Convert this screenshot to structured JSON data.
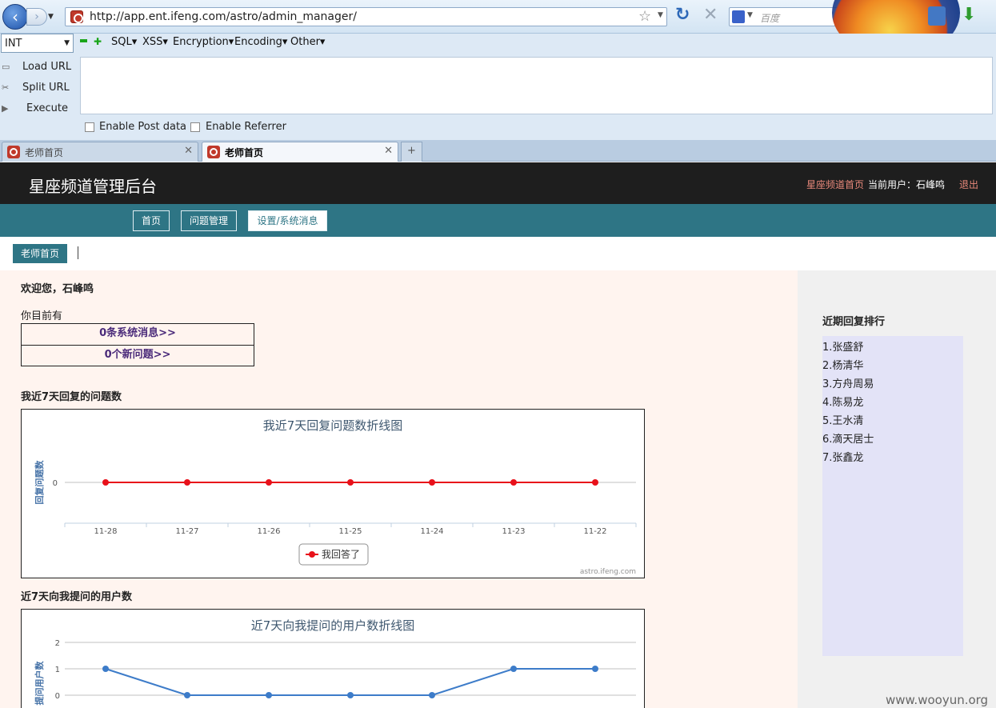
{
  "browser": {
    "url": "http://app.ent.ifeng.com/astro/admin_manager/",
    "search_placeholder": "百度",
    "back_glyph": "‹",
    "forward_glyph": "›",
    "reload_glyph": "↻",
    "stop_glyph": "✕",
    "star_glyph": "☆"
  },
  "hackbar": {
    "select_value": "INT",
    "menus": [
      "SQL",
      "XSS",
      "Encryption",
      "Encoding",
      "Other"
    ],
    "actions": [
      "Load URL",
      "Split URL",
      "Execute"
    ],
    "checkboxes": [
      "Enable Post data",
      "Enable Referrer"
    ]
  },
  "tabs": [
    {
      "title": "老师首页",
      "active": false
    },
    {
      "title": "老师首页",
      "active": true
    }
  ],
  "site": {
    "title": "星座频道管理后台",
    "home_link": "星座频道首页",
    "current_user": "当前用户：石峰鸣",
    "logout": "退出"
  },
  "nav": [
    {
      "label": "首页",
      "active": false
    },
    {
      "label": "问题管理",
      "active": false
    },
    {
      "label": "设置/系统消息",
      "active": true
    }
  ],
  "breadcrumb": "老师首页",
  "main": {
    "welcome": "欢迎您，石峰鸣",
    "current": "你目前有",
    "messages": "0条系统消息>>",
    "questions": "0个新问题>>",
    "section1": "我近7天回复的问题数",
    "section2": "近7天向我提问的用户数"
  },
  "sidebar": {
    "title": "近期回复排行",
    "items": [
      "1.张盛舒",
      "2.杨清华",
      "3.方舟周易",
      "4.陈易龙",
      "5.王水清",
      "6.滴天居士",
      "7.张鑫龙"
    ]
  },
  "chart_data": [
    {
      "type": "line",
      "title": "我近7天回复问题数折线图",
      "ylabel": "回复问题数",
      "categories": [
        "11-28",
        "11-27",
        "11-26",
        "11-25",
        "11-24",
        "11-23",
        "11-22"
      ],
      "yticks": [
        0
      ],
      "series": [
        {
          "name": "我回答了",
          "values": [
            0,
            0,
            0,
            0,
            0,
            0,
            0
          ],
          "color": "#e8111a"
        }
      ],
      "legend": "bottom-center",
      "credit": "astro.ifeng.com"
    },
    {
      "type": "line",
      "title": "近7天向我提问的用户数折线图",
      "ylabel": "提问用户数",
      "yticks": [
        0,
        1,
        2
      ],
      "ylim": [
        0,
        2
      ],
      "series": [
        {
          "values": [
            1,
            0,
            0,
            0,
            0,
            1,
            1
          ],
          "color": "#3d7cc9"
        }
      ]
    }
  ],
  "watermark": "www.wooyun.org"
}
